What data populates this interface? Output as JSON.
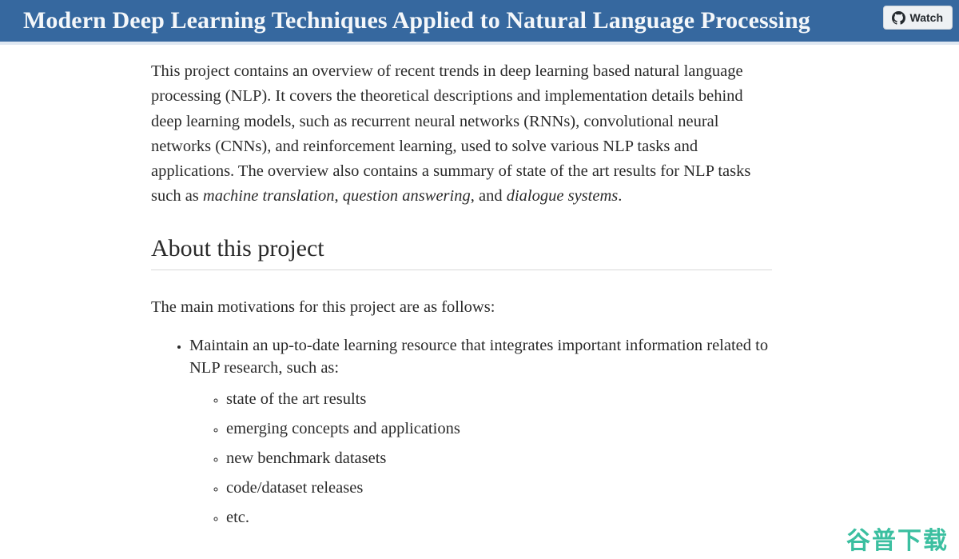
{
  "header": {
    "title": "Modern Deep Learning Techniques Applied to Natural Language Processing",
    "background_color": "#36689f",
    "title_color": "#f4f7fa",
    "watch_button": {
      "label": "Watch",
      "icon": "github-octocat-icon",
      "background_color": "#eef1f4",
      "text_color": "#24292e"
    }
  },
  "main": {
    "intro": {
      "part1": "This project contains an overview of recent trends in deep learning based natural language processing (NLP). It covers the theoretical descriptions and implementation details behind deep learning models, such as recurrent neural networks (RNNs), convolutional neural networks (CNNs), and reinforcement learning, used to solve various NLP tasks and applications. The overview also contains a summary of state of the art results for NLP tasks such as ",
      "em1": "machine translation",
      "part2": ", ",
      "em2": "question answering",
      "part3": ", and ",
      "em3": "dialogue systems",
      "part4": "."
    },
    "about_heading": "About this project",
    "motivations_lead": "The main motivations for this project are as follows:",
    "bullets": [
      {
        "text": "Maintain an up-to-date learning resource that integrates important information related to NLP research, such as:",
        "subitems": [
          "state of the art results",
          "emerging concepts and applications",
          "new benchmark datasets",
          "code/dataset releases",
          "etc."
        ]
      }
    ]
  },
  "watermark": {
    "text": "谷普下载",
    "color": "#3bbfa0"
  }
}
